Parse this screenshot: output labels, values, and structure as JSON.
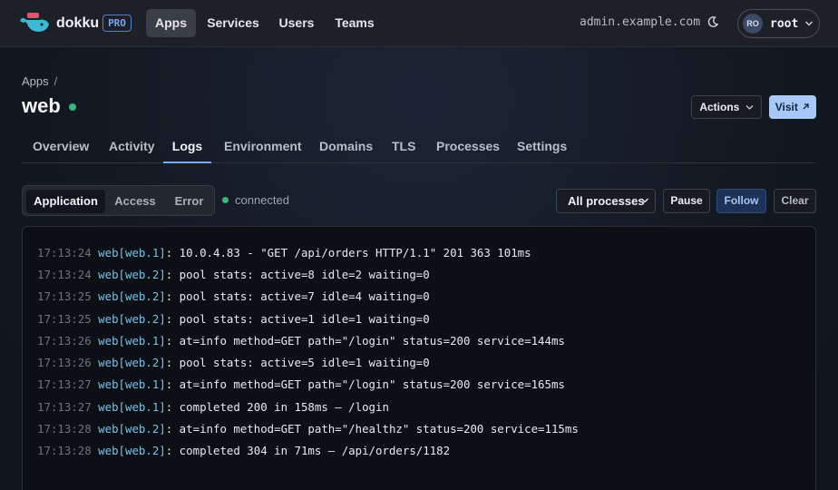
{
  "brand": {
    "name": "dokku",
    "badge": "PRO"
  },
  "nav": {
    "items": [
      "Apps",
      "Services",
      "Users",
      "Teams"
    ],
    "active": "Apps"
  },
  "host": "admin.example.com",
  "user": {
    "initials": "RO",
    "name": "root"
  },
  "breadcrumb": {
    "root": "Apps",
    "separator": "/"
  },
  "app": {
    "name": "web",
    "status_color": "#3fb27f"
  },
  "header_buttons": {
    "actions": "Actions",
    "visit": "Visit"
  },
  "tabs": [
    "Overview",
    "Activity",
    "Logs",
    "Environment",
    "Domains",
    "TLS",
    "Processes",
    "Settings"
  ],
  "active_tab": "Logs",
  "log_types": [
    "Application",
    "Access",
    "Error"
  ],
  "active_log_type": "Application",
  "connection": "connected",
  "log_controls": {
    "process_select": "All processes",
    "pause": "Pause",
    "follow": "Follow",
    "clear": "Clear"
  },
  "logs": [
    {
      "time": "17:13:24",
      "source": "web[web.1]",
      "message": ": 10.0.4.83 - \"GET /api/orders HTTP/1.1\" 201 363 101ms"
    },
    {
      "time": "17:13:24",
      "source": "web[web.2]",
      "message": ": pool stats: active=8 idle=2 waiting=0"
    },
    {
      "time": "17:13:25",
      "source": "web[web.2]",
      "message": ": pool stats: active=7 idle=4 waiting=0"
    },
    {
      "time": "17:13:25",
      "source": "web[web.2]",
      "message": ": pool stats: active=1 idle=1 waiting=0"
    },
    {
      "time": "17:13:26",
      "source": "web[web.1]",
      "message": ": at=info method=GET path=\"/login\" status=200 service=144ms"
    },
    {
      "time": "17:13:26",
      "source": "web[web.2]",
      "message": ": pool stats: active=5 idle=1 waiting=0"
    },
    {
      "time": "17:13:27",
      "source": "web[web.1]",
      "message": ": at=info method=GET path=\"/login\" status=200 service=165ms"
    },
    {
      "time": "17:13:27",
      "source": "web[web.1]",
      "message": ": completed 200 in 158ms — /login"
    },
    {
      "time": "17:13:28",
      "source": "web[web.2]",
      "message": ": at=info method=GET path=\"/healthz\" status=200 service=115ms"
    },
    {
      "time": "17:13:28",
      "source": "web[web.2]",
      "message": ": completed 304 in 71ms — /api/orders/1182"
    }
  ],
  "colors": {
    "accent": "#7aa7f0",
    "visit_button": "#a8c9f7",
    "status_green": "#3fb27f",
    "log_source": "#78c2e8"
  }
}
